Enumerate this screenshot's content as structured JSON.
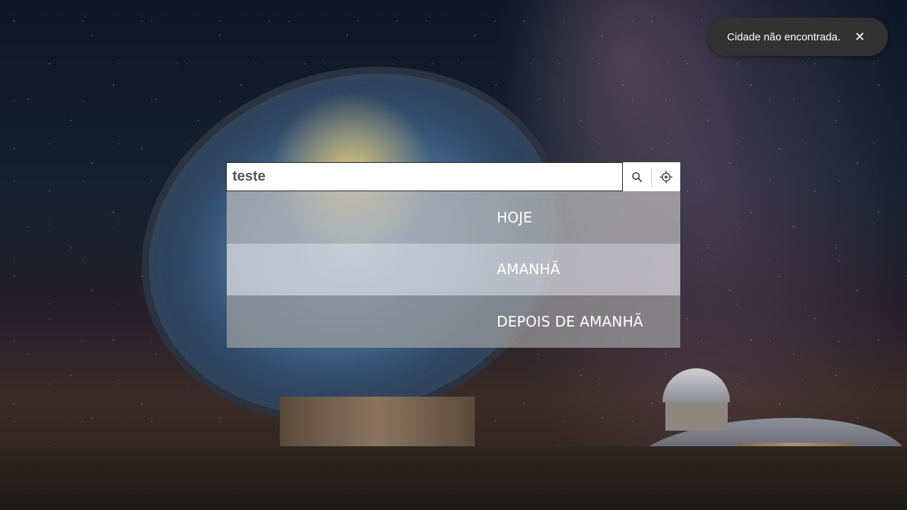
{
  "toast": {
    "message": "Cidade não encontrada.",
    "close_symbol": "✕"
  },
  "search": {
    "value": "teste",
    "search_icon": "search-icon",
    "location_icon": "my-location-icon"
  },
  "forecast_tabs": [
    {
      "label": "HOJE"
    },
    {
      "label": "AMANHÃ"
    },
    {
      "label": "DEPOIS DE AMANHÃ"
    }
  ],
  "colors": {
    "toast_bg": "#323232",
    "input_bg": "#ffffff",
    "text_light": "#ffffff"
  }
}
